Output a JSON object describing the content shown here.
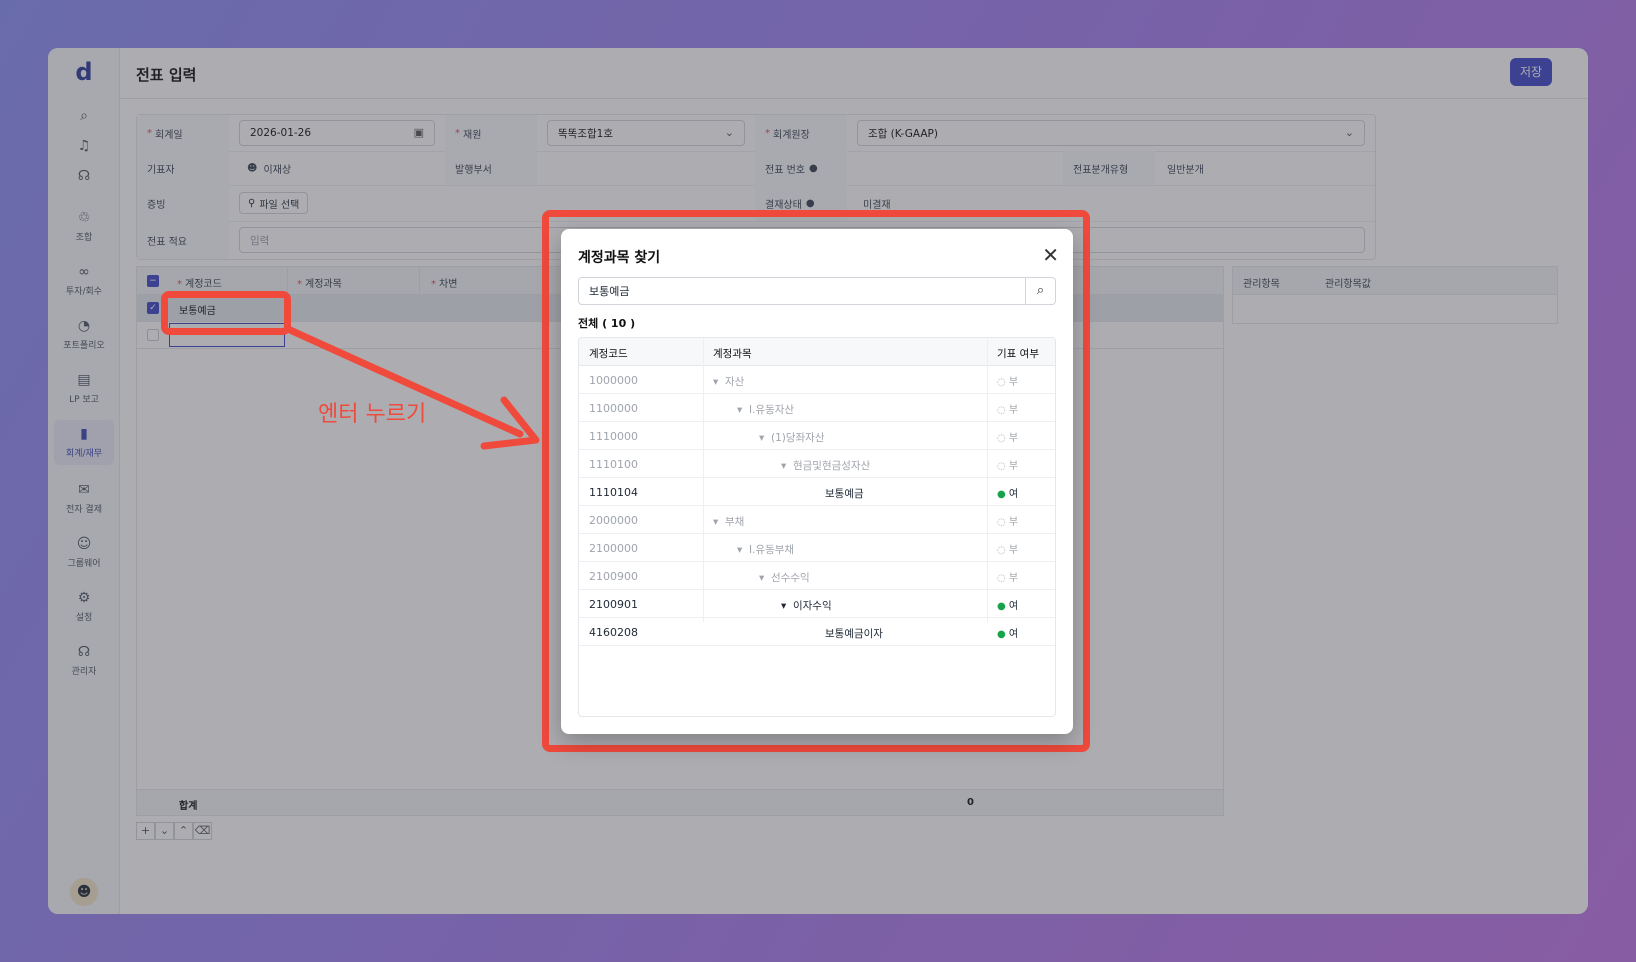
{
  "app": {
    "logo": "d",
    "page_title": "전표 입력",
    "save_label": "저장"
  },
  "sidebar": {
    "top_icons": [
      "search-icon",
      "bell-icon",
      "headset-icon"
    ],
    "items": [
      {
        "label": "조합",
        "icon": "♲"
      },
      {
        "label": "투자/회수",
        "icon": "∞"
      },
      {
        "label": "포트폴리오",
        "icon": "◔"
      },
      {
        "label": "LP 보고",
        "icon": "▤"
      },
      {
        "label": "회계/재무",
        "icon": "▮"
      },
      {
        "label": "전자 결제",
        "icon": "✉"
      },
      {
        "label": "그룹웨어",
        "icon": "☺"
      },
      {
        "label": "설정",
        "icon": "⚙"
      },
      {
        "label": "관리자",
        "icon": "☊"
      }
    ]
  },
  "form": {
    "date_label": "회계일",
    "date_value": "2026-01-26",
    "fund_label": "재원",
    "fund_value": "똑똑조합1호",
    "ledger_label": "회계원장",
    "ledger_value": "조합 (K-GAAP)",
    "author_label": "기표자",
    "author_value": "이재상",
    "dept_label": "발행부서",
    "voucher_no_label": "전표 번호",
    "voucher_type_label": "전표분개유형",
    "voucher_type_value": "일반분개",
    "evidence_label": "증빙",
    "file_button": "파일 선택",
    "approval_label": "결재상태",
    "approval_value": "미결재",
    "memo_label": "전표 적요",
    "memo_placeholder": "입력"
  },
  "grid": {
    "headers": [
      "계정코드",
      "계정과목",
      "차변"
    ],
    "rows": [
      {
        "code": "보통예금"
      }
    ],
    "footer_label": "합계",
    "footer_total": "0",
    "side_headers": [
      "관리항목",
      "관리항목값"
    ]
  },
  "annotation": "엔터 누르기",
  "modal": {
    "title": "계정과목 찾기",
    "search_value": "보통예금",
    "count_label": "전체 ( 10 )",
    "headers": [
      "계정코드",
      "계정과목",
      "기표 여부"
    ],
    "rows": [
      {
        "code": "1000000",
        "name": "자산",
        "flag": "부"
      },
      {
        "code": "1100000",
        "name": "I.유동자산",
        "flag": "부"
      },
      {
        "code": "1110000",
        "name": "(1)당좌자산",
        "flag": "부"
      },
      {
        "code": "1110100",
        "name": "현금및현금성자산",
        "flag": "부"
      },
      {
        "code": "1110104",
        "name": "보통예금",
        "flag": "여"
      },
      {
        "code": "2000000",
        "name": "부채",
        "flag": "부"
      },
      {
        "code": "2100000",
        "name": "I.유동부채",
        "flag": "부"
      },
      {
        "code": "2100900",
        "name": "선수수익",
        "flag": "부"
      },
      {
        "code": "2100901",
        "name": "이자수익",
        "flag": "여"
      },
      {
        "code": "4160208",
        "name": "보통예금이자",
        "flag": "여"
      }
    ]
  },
  "colors": {
    "accent": "#3d47c9",
    "annotation": "#ef4a3c",
    "ok": "#16a34a"
  }
}
